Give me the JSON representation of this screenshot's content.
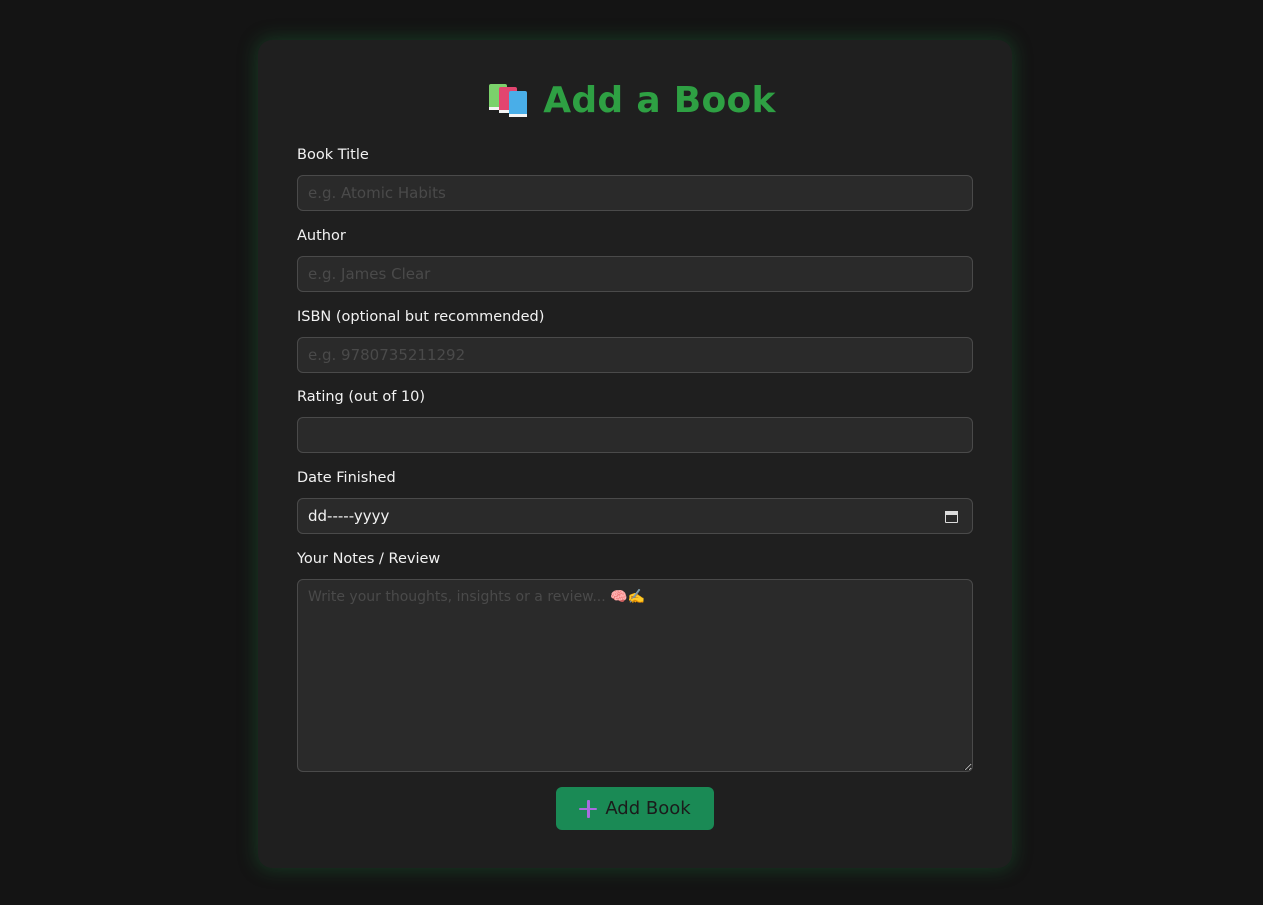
{
  "page": {
    "title": "Add a Book",
    "title_icon": "books-icon",
    "accent_color": "#2ea043"
  },
  "form": {
    "fields": {
      "title": {
        "label": "Book Title",
        "placeholder": "e.g. Atomic Habits",
        "value": ""
      },
      "author": {
        "label": "Author",
        "placeholder": "e.g. James Clear",
        "value": ""
      },
      "isbn": {
        "label": "ISBN (optional but recommended)",
        "placeholder": "e.g. 9780735211292",
        "value": ""
      },
      "rating": {
        "label": "Rating (out of 10)",
        "placeholder": "",
        "value": ""
      },
      "date_finished": {
        "label": "Date Finished",
        "value": "dd-----yyyy",
        "icon": "calendar-icon"
      },
      "notes": {
        "label": "Your Notes / Review",
        "placeholder": "Write your thoughts, insights or a review... 🧠✍️",
        "value": ""
      }
    },
    "submit": {
      "label": "Add Book",
      "icon": "plus-icon",
      "color": "#1a8a55"
    }
  }
}
